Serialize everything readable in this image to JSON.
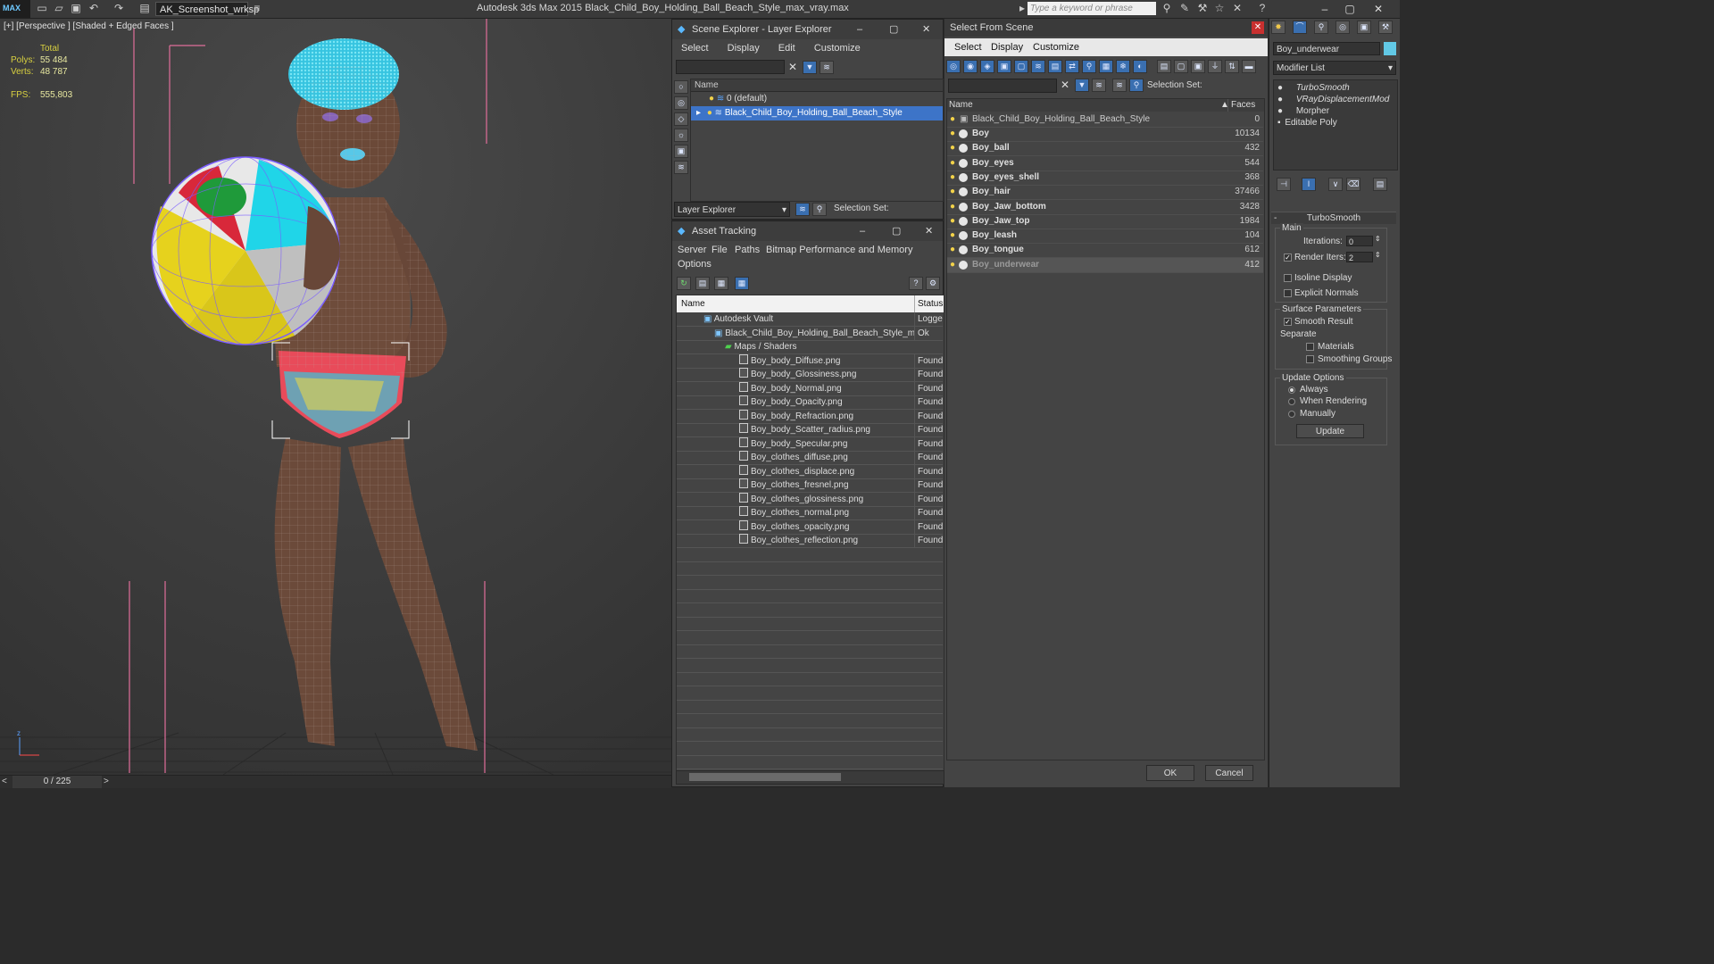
{
  "titlebar": {
    "logo": "MAX",
    "workspace": "AK_Screenshot_wrksp",
    "app_title": "Autodesk 3ds Max  2015    Black_Child_Boy_Holding_Ball_Beach_Style_max_vray.max",
    "search_placeholder": "Type a keyword or phrase"
  },
  "viewport": {
    "label": "[+] [Perspective ] [Shaded + Edged Faces ]",
    "stats": {
      "total_label": "Total",
      "polys_label": "Polys:",
      "polys": "55 484",
      "verts_label": "Verts:",
      "verts": "48 787",
      "fps_label": "FPS:",
      "fps": "555,803"
    },
    "frame_counter": "0 / 225"
  },
  "scene_explorer": {
    "title": "Scene Explorer - Layer Explorer",
    "menu": [
      "Select",
      "Display",
      "Edit",
      "Customize"
    ],
    "column_name": "Name",
    "layers": [
      {
        "name": "0 (default)",
        "selected": false
      },
      {
        "name": "Black_Child_Boy_Holding_Ball_Beach_Style",
        "selected": true
      }
    ],
    "footer_dropdown": "Layer Explorer",
    "selection_set_label": "Selection Set:"
  },
  "asset_tracking": {
    "title": "Asset Tracking",
    "menu": [
      "Server",
      "File",
      "Paths",
      "Bitmap Performance and Memory",
      "Options"
    ],
    "col_name": "Name",
    "col_status": "Status",
    "rows": [
      {
        "name": "Autodesk Vault",
        "status": "Logged",
        "level": 0
      },
      {
        "name": "Black_Child_Boy_Holding_Ball_Beach_Style_max...",
        "status": "Ok",
        "level": 1
      },
      {
        "name": "Maps / Shaders",
        "status": "",
        "level": 2
      },
      {
        "name": "Boy_body_Diffuse.png",
        "status": "Found",
        "level": 3
      },
      {
        "name": "Boy_body_Glossiness.png",
        "status": "Found",
        "level": 3
      },
      {
        "name": "Boy_body_Normal.png",
        "status": "Found",
        "level": 3
      },
      {
        "name": "Boy_body_Opacity.png",
        "status": "Found",
        "level": 3
      },
      {
        "name": "Boy_body_Refraction.png",
        "status": "Found",
        "level": 3
      },
      {
        "name": "Boy_body_Scatter_radius.png",
        "status": "Found",
        "level": 3
      },
      {
        "name": "Boy_body_Specular.png",
        "status": "Found",
        "level": 3
      },
      {
        "name": "Boy_clothes_diffuse.png",
        "status": "Found",
        "level": 3
      },
      {
        "name": "Boy_clothes_displace.png",
        "status": "Found",
        "level": 3
      },
      {
        "name": "Boy_clothes_fresnel.png",
        "status": "Found",
        "level": 3
      },
      {
        "name": "Boy_clothes_glossiness.png",
        "status": "Found",
        "level": 3
      },
      {
        "name": "Boy_clothes_normal.png",
        "status": "Found",
        "level": 3
      },
      {
        "name": "Boy_clothes_opacity.png",
        "status": "Found",
        "level": 3
      },
      {
        "name": "Boy_clothes_reflection.png",
        "status": "Found",
        "level": 3
      }
    ]
  },
  "select_from_scene": {
    "title": "Select From Scene",
    "menu": [
      "Select",
      "Display",
      "Customize"
    ],
    "selection_set_label": "Selection Set:",
    "col_name": "Name",
    "col_faces": "Faces",
    "root": {
      "name": "Black_Child_Boy_Holding_Ball_Beach_Style",
      "faces": "0"
    },
    "objects": [
      {
        "name": "Boy",
        "faces": "10134",
        "selected": false
      },
      {
        "name": "Boy_ball",
        "faces": "432",
        "selected": false
      },
      {
        "name": "Boy_eyes",
        "faces": "544",
        "selected": false
      },
      {
        "name": "Boy_eyes_shell",
        "faces": "368",
        "selected": false
      },
      {
        "name": "Boy_hair",
        "faces": "37466",
        "selected": false
      },
      {
        "name": "Boy_Jaw_bottom",
        "faces": "3428",
        "selected": false
      },
      {
        "name": "Boy_Jaw_top",
        "faces": "1984",
        "selected": false
      },
      {
        "name": "Boy_leash",
        "faces": "104",
        "selected": false
      },
      {
        "name": "Boy_tongue",
        "faces": "612",
        "selected": false
      },
      {
        "name": "Boy_underwear",
        "faces": "412",
        "selected": true
      }
    ],
    "ok_label": "OK",
    "cancel_label": "Cancel"
  },
  "command_panel": {
    "object_name": "Boy_underwear",
    "modifier_list_label": "Modifier List",
    "stack": [
      "TurboSmooth",
      "VRayDisplacementMod",
      "Morpher",
      "Editable Poly"
    ],
    "rollout_title": "TurboSmooth",
    "main_label": "Main",
    "iterations_label": "Iterations:",
    "iterations": "0",
    "render_iters_label": "Render Iters:",
    "render_iters": "2",
    "isoline_label": "Isoline Display",
    "explicit_normals_label": "Explicit Normals",
    "surface_params_label": "Surface Parameters",
    "smooth_result_label": "Smooth Result",
    "separate_label": "Separate",
    "materials_label": "Materials",
    "smoothing_groups_label": "Smoothing Groups",
    "update_options_label": "Update Options",
    "always_label": "Always",
    "when_rendering_label": "When Rendering",
    "manually_label": "Manually",
    "update_button": "Update"
  },
  "colors": {
    "selection_blue": "#3d74c8",
    "wire_purple": "#7a5cff",
    "stats_yellow": "#d8d040",
    "hair_cyan": "#3fd2ea"
  }
}
